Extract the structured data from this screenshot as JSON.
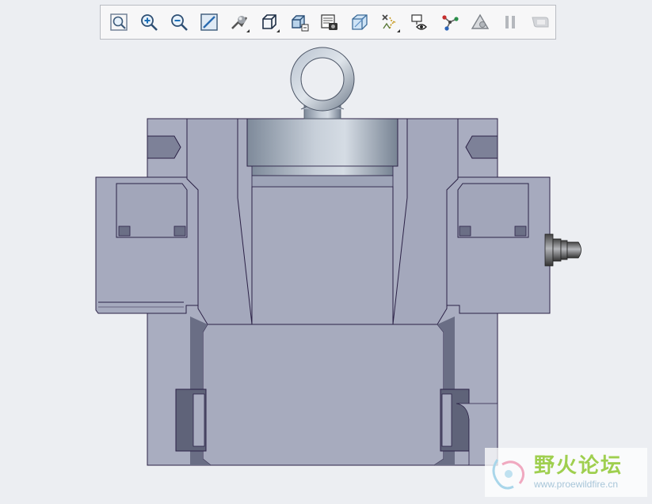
{
  "toolbar": {
    "buttons": [
      {
        "name": "refit",
        "icon": "zoom-fit-icon"
      },
      {
        "name": "zoom-in",
        "icon": "zoom-in-icon"
      },
      {
        "name": "zoom-out",
        "icon": "zoom-out-icon"
      },
      {
        "name": "repaint",
        "icon": "repaint-icon"
      },
      {
        "name": "display-style",
        "icon": "shaded-sphere-icon"
      },
      {
        "name": "saved-orientations",
        "icon": "cube-view-icon"
      },
      {
        "name": "view-manager",
        "icon": "view-manager-icon"
      },
      {
        "name": "perspective",
        "icon": "perspective-icon"
      },
      {
        "name": "section",
        "icon": "section-cube-icon"
      },
      {
        "name": "datum-display",
        "icon": "datum-display-icon"
      },
      {
        "name": "annotation-display",
        "icon": "annotation-eye-icon"
      },
      {
        "name": "spin-center",
        "icon": "spin-center-icon"
      },
      {
        "name": "appearance",
        "icon": "appearance-icon"
      },
      {
        "name": "pause",
        "icon": "pause-icon"
      },
      {
        "name": "more",
        "icon": "more-icon"
      }
    ]
  },
  "colors": {
    "background": "#eceef2",
    "part_fill": "#a8acbf",
    "part_dark": "#6c7087",
    "outline": "#2b2146",
    "steel_light": "#c6ced8",
    "steel_dark": "#7a8797"
  },
  "watermark": {
    "title": "野火论坛",
    "url": "www.proewildfire.cn"
  }
}
